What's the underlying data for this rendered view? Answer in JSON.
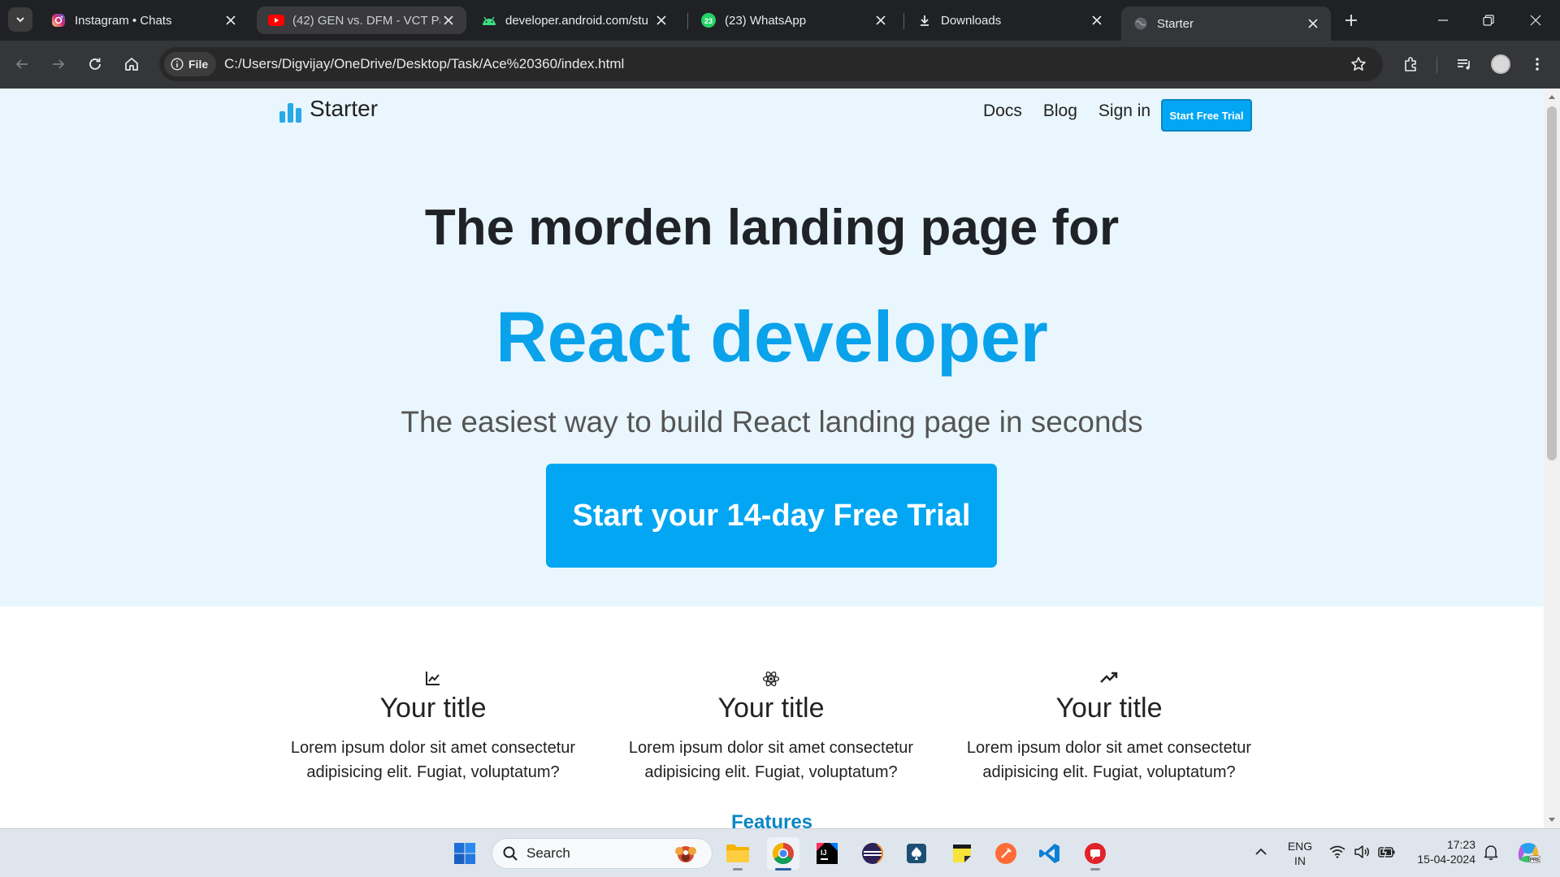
{
  "browser": {
    "tabs": [
      {
        "title": "Instagram • Chats",
        "icon": "instagram-icon",
        "active": false
      },
      {
        "title": "(42) GEN vs. DFM - VCT Pa",
        "icon": "youtube-icon",
        "active": false
      },
      {
        "title": "developer.android.com/stu",
        "icon": "android-icon",
        "active": false
      },
      {
        "title": "(23) WhatsApp",
        "icon": "whatsapp-icon",
        "active": false
      },
      {
        "title": "Downloads",
        "icon": "download-icon",
        "active": false
      },
      {
        "title": "Starter",
        "icon": "globe-icon",
        "active": true
      }
    ],
    "address": {
      "chip": "File",
      "url": "C:/Users/Digvijay/OneDrive/Desktop/Task/Ace%20360/index.html"
    }
  },
  "page": {
    "logo": "Starter",
    "nav": {
      "docs": "Docs",
      "blog": "Blog",
      "signin": "Sign in",
      "cta": "Start Free Trial"
    },
    "hero": {
      "headline": "The morden landing page for",
      "highlight": "React developer",
      "subtitle": "The easiest way to build React landing page in seconds",
      "cta": "Start your 14-day Free Trial"
    },
    "features": [
      {
        "icon": "line-chart-icon",
        "title": "Your title",
        "desc_1": "Lorem ipsum dolor sit amet consectetur",
        "desc_2": "adipisicing elit. Fugiat, voluptatum?"
      },
      {
        "icon": "react-atom-icon",
        "title": "Your title",
        "desc_1": "Lorem ipsum dolor sit amet consectetur",
        "desc_2": "adipisicing elit. Fugiat, voluptatum?"
      },
      {
        "icon": "trending-up-icon",
        "title": "Your title",
        "desc_1": "Lorem ipsum dolor sit amet consectetur",
        "desc_2": "adipisicing elit. Fugiat, voluptatum?"
      }
    ],
    "features_heading": "Features",
    "colors": {
      "accent": "#02a6f2",
      "hero_bg": "#e9f6fd",
      "heading": "#0aa2ea"
    }
  },
  "taskbar": {
    "search": "Search",
    "lang_1": "ENG",
    "lang_2": "IN",
    "time": "17:23",
    "date": "15-04-2024"
  }
}
